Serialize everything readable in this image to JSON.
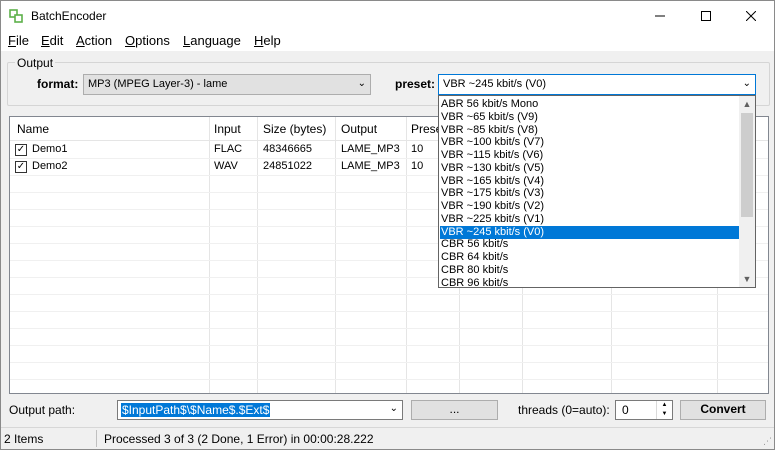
{
  "window": {
    "title": "BatchEncoder"
  },
  "menu": [
    "File",
    "Edit",
    "Action",
    "Options",
    "Language",
    "Help"
  ],
  "output_group": {
    "label": "Output",
    "format_label": "format:",
    "format_value": "MP3 (MPEG Layer-3) - lame",
    "preset_label": "preset:",
    "preset_value": "VBR ~245 kbit/s (V0)"
  },
  "list": {
    "columns": [
      "Name",
      "Input",
      "Size (bytes)",
      "Output",
      "Prese"
    ],
    "rows": [
      {
        "checked": true,
        "name": "Demo1",
        "input": "FLAC",
        "size": "48346665",
        "output": "LAME_MP3",
        "preset": "10"
      },
      {
        "checked": true,
        "name": "Demo2",
        "input": "WAV",
        "size": "24851022",
        "output": "LAME_MP3",
        "preset": "10"
      }
    ]
  },
  "preset_options": [
    "ABR 56 kbit/s Mono",
    "VBR ~65 kbit/s (V9)",
    "VBR ~85 kbit/s (V8)",
    "VBR ~100 kbit/s (V7)",
    "VBR ~115 kbit/s (V6)",
    "VBR ~130 kbit/s (V5)",
    "VBR ~165 kbit/s (V4)",
    "VBR ~175 kbit/s (V3)",
    "VBR ~190 kbit/s (V2)",
    "VBR ~225 kbit/s (V1)",
    "VBR ~245 kbit/s (V0)",
    "CBR 56 kbit/s",
    "CBR 64 kbit/s",
    "CBR 80 kbit/s",
    "CBR 96 kbit/s"
  ],
  "selected_option_index": 10,
  "bottom": {
    "output_path_label": "Output path:",
    "output_path_value": "$InputPath$\\$Name$.$Ext$",
    "browse_label": "...",
    "threads_label": "threads (0=auto):",
    "threads_value": "0",
    "convert_label": "Convert"
  },
  "status": {
    "items": "2 Items",
    "message": "Processed 3 of 3 (2 Done, 1 Error) in 00:00:28.222"
  },
  "colors": {
    "accent": "#0078d7",
    "app_icon": "#5db04a"
  }
}
